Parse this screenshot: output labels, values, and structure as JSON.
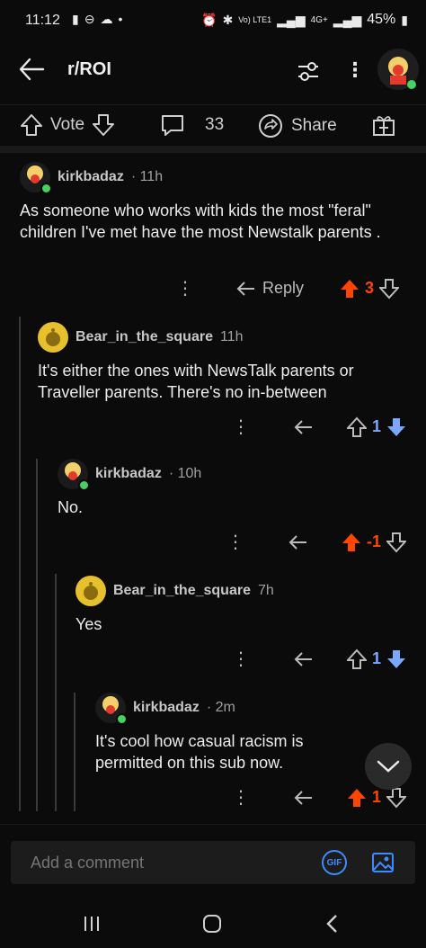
{
  "status": {
    "time": "11:12",
    "battery": "45%",
    "network": "4G+",
    "volte": "Vo) LTE1"
  },
  "nav": {
    "title": "r/ROI"
  },
  "post_actions": {
    "vote_label": "Vote",
    "comment_count": "33",
    "share_label": "Share"
  },
  "comments": [
    {
      "user": "kirkbadaz",
      "time": "11h",
      "body": "As someone who works with kids the most \"feral\" children I've met have the most Newstalk parents .",
      "reply_label": "Reply",
      "score": "3"
    },
    {
      "user": "Bear_in_the_square",
      "time": "11h",
      "body": "It's either the ones with NewsTalk parents or Traveller parents. There's no in-between",
      "score": "1"
    },
    {
      "user": "kirkbadaz",
      "time": "10h",
      "body": "No.",
      "score": "-1"
    },
    {
      "user": "Bear_in_the_square",
      "time": "7h",
      "body": "Yes",
      "score": "1"
    },
    {
      "user": "kirkbadaz",
      "time": "2m",
      "body": "It's cool how casual racism is permitted on this sub now.",
      "score": "1"
    }
  ],
  "composer": {
    "placeholder": "Add a comment",
    "gif_label": "GIF"
  },
  "colors": {
    "upvote": "#ff4500",
    "downvote_active": "#7aa7ff",
    "background": "#0b0b0b"
  },
  "icons": [
    "back-arrow-icon",
    "filter-icon",
    "more-icon",
    "upvote-icon",
    "downvote-icon",
    "comment-icon",
    "share-icon",
    "award-icon",
    "reply-icon",
    "image-icon",
    "chevron-down-icon"
  ]
}
